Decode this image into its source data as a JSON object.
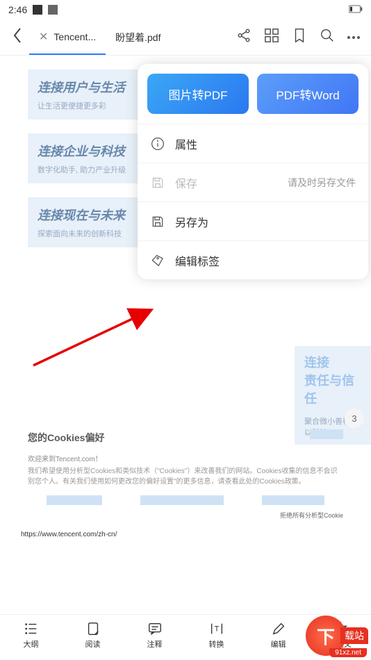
{
  "status": {
    "time": "2:46"
  },
  "tabs": [
    {
      "label": "Tencent..."
    },
    {
      "label": "盼望着.pdf"
    }
  ],
  "page_sections": [
    {
      "title": "连接用户与生活",
      "sub": "让生活更便捷更多彩"
    },
    {
      "title": "连接企业与科技",
      "sub": "数字化助手, 助力产业升级"
    },
    {
      "title": "连接现在与未来",
      "sub": "探索面向未来的创新科技"
    }
  ],
  "popup": {
    "convert1": "图片转PDF",
    "convert2": "PDF转Word",
    "items": {
      "props": "属性",
      "save": "保存",
      "save_hint": "请及时另存文件",
      "saveas": "另存为",
      "tags": "编辑标签"
    }
  },
  "side_card": {
    "l1": "连接",
    "l2": "责任与信任",
    "sub": "聚合微小善行，以科技"
  },
  "page_number": "3",
  "cookies": {
    "title": "您的Cookies偏好",
    "p1": "欢迎来到Tencent.com！",
    "p2": "我们希望使用分析型Cookies和类似技术（\"Cookies\"）来改善我们的网站。Cookies收集的信息不会识别您个人。有关我们使用如何更改您的偏好设置\"的更多信息，请查看此处的Cookies政策。",
    "reject": "拒绝所有分析型Cookie"
  },
  "url": "https://www.tencent.com/zh-cn/",
  "nav": [
    {
      "label": "大纲"
    },
    {
      "label": "阅读"
    },
    {
      "label": "注释"
    },
    {
      "label": "转换"
    },
    {
      "label": "编辑"
    },
    {
      "label": "自定义"
    }
  ],
  "watermark": {
    "letter": "下",
    "text": "载站",
    "url": "91xz.net"
  }
}
